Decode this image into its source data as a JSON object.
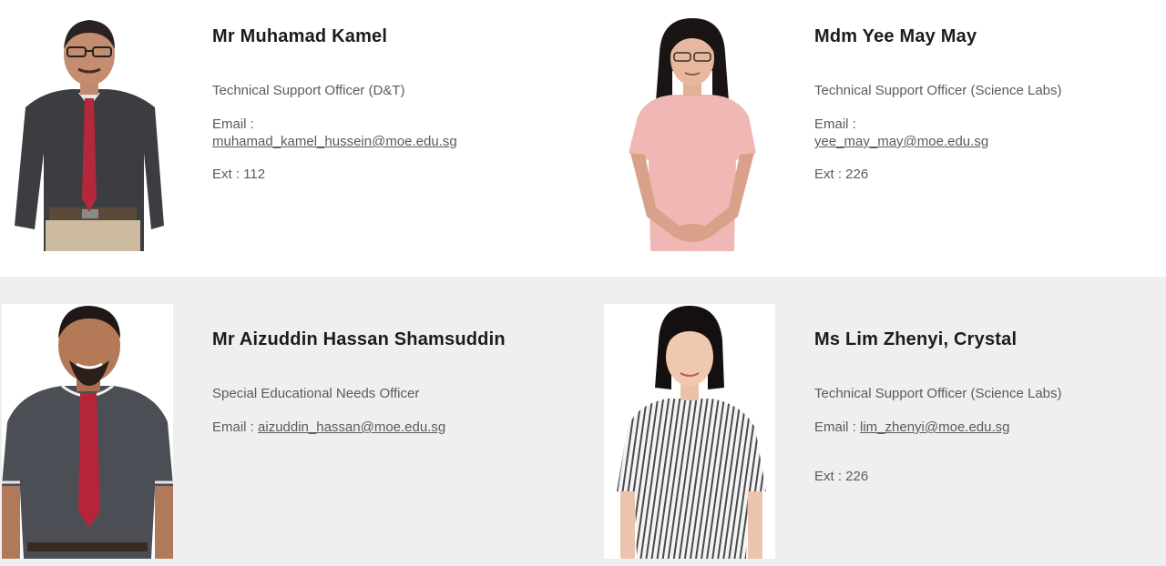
{
  "staff": [
    {
      "name": "Mr Muhamad Kamel",
      "role": "Technical Support Officer (D&T)",
      "email_label": "Email :",
      "email": "muhamad_kamel_hussein@moe.edu.sg",
      "ext": "Ext : 112"
    },
    {
      "name": "Mdm Yee May May",
      "role": "Technical Support Officer (Science Labs)",
      "email_label": "Email :",
      "email": "yee_may_may@moe.edu.sg",
      "ext": "Ext : 226"
    },
    {
      "name": "Mr Aizuddin Hassan Shamsuddin",
      "role": "Special Educational Needs Officer",
      "email_label": "Email :",
      "email": "aizuddin_hassan@moe.edu.sg"
    },
    {
      "name": "Ms Lim Zhenyi, Crystal",
      "role": "Technical Support Officer (Science Labs)",
      "email_label": "Email :",
      "email": "lim_zhenyi@moe.edu.sg",
      "ext": "Ext : 226"
    }
  ],
  "colors": {
    "row_alt_bg": "#efefef",
    "name_text": "#1c1c1c",
    "body_text": "#5b5b5b"
  }
}
